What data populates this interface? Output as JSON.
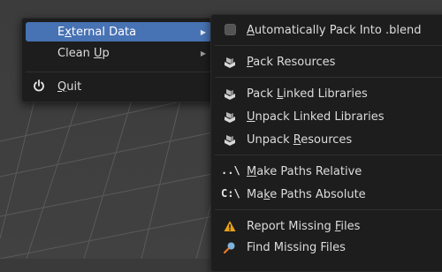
{
  "main_menu": {
    "items": [
      {
        "label_pre": "E",
        "label_u": "x",
        "label_post": "ternal Data",
        "has_submenu": true,
        "active": true
      },
      {
        "label_pre": "Clean ",
        "label_u": "U",
        "label_post": "p",
        "has_submenu": true,
        "active": false
      },
      {
        "label_pre": "",
        "label_u": "Q",
        "label_post": "uit",
        "icon": "power-icon",
        "has_submenu": false,
        "active": false
      }
    ]
  },
  "submenu": {
    "items": [
      {
        "icon": "checkbox-icon",
        "label_pre": "",
        "label_u": "A",
        "label_post": "utomatically Pack Into .blend"
      },
      {
        "icon": "package-icon",
        "label_pre": "",
        "label_u": "P",
        "label_post": "ack Resources"
      },
      {
        "icon": "package-icon",
        "label_pre": "Pack ",
        "label_u": "L",
        "label_post": "inked Libraries"
      },
      {
        "icon": "package-icon",
        "label_pre": "",
        "label_u": "U",
        "label_post": "npack Linked Libraries"
      },
      {
        "icon": "package-icon",
        "label_pre": "Unpack ",
        "label_u": "R",
        "label_post": "esources"
      },
      {
        "icon": "relative-path-icon",
        "icon_text": "..\\",
        "label_pre": "",
        "label_u": "M",
        "label_post": "ake Paths Relative"
      },
      {
        "icon": "absolute-path-icon",
        "icon_text": "C:\\",
        "label_pre": "Ma",
        "label_u": "k",
        "label_post": "e Paths Absolute"
      },
      {
        "icon": "warning-icon",
        "label_pre": "Report Missing ",
        "label_u": "F",
        "label_post": "iles"
      },
      {
        "icon": "find-icon",
        "label_pre": "Find Missing Files",
        "label_u": "",
        "label_post": ""
      }
    ]
  },
  "colors": {
    "menu_bg": "#1d1d1d",
    "highlight": "#4772b3",
    "text": "#dcdcdc",
    "viewport_bg": "#3c3c3c"
  }
}
